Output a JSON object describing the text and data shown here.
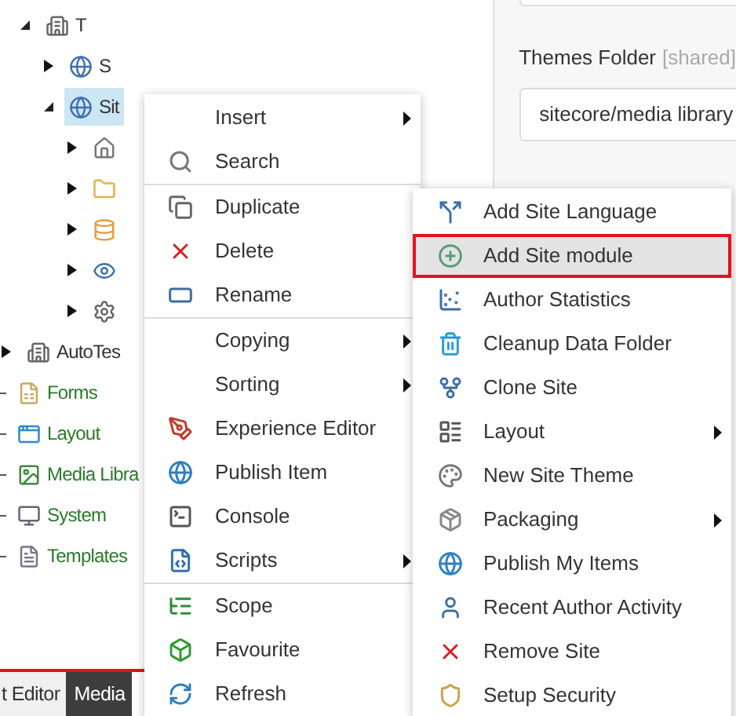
{
  "tree": [
    {
      "children": [
        {
          "label": "T",
          "kind": "building",
          "expanded": true,
          "selected": false,
          "children": [
            {
              "label": "S",
              "kind": "globe",
              "expanded": false,
              "selected": false
            },
            {
              "label": "Sit",
              "kind": "globe",
              "expanded": true,
              "selected": true,
              "children": [
                {
                  "kind": "home",
                  "expanded": false,
                  "selected": false
                },
                {
                  "kind": "folder",
                  "expanded": false,
                  "selected": false
                },
                {
                  "kind": "data",
                  "expanded": false,
                  "selected": false
                },
                {
                  "kind": "eye",
                  "expanded": false,
                  "selected": false
                },
                {
                  "kind": "gear",
                  "expanded": false,
                  "selected": false
                }
              ]
            }
          ]
        }
      ]
    },
    {
      "label": "AutoTes",
      "kind": "building",
      "expanded": false,
      "selected": false
    },
    {
      "label": "Forms",
      "kind": "forms",
      "selected": false,
      "color": "#2b7a2b"
    },
    {
      "label": "Layout",
      "kind": "layout",
      "selected": false,
      "color": "#2b7a2b"
    },
    {
      "label": "Media Libra",
      "kind": "media",
      "selected": false,
      "color": "#2b7a2b"
    },
    {
      "label": "System",
      "kind": "system",
      "selected": false,
      "color": "#2b7a2b"
    },
    {
      "label": "Templates",
      "kind": "templates",
      "selected": false,
      "color": "#2b7a2b"
    }
  ],
  "editor": {
    "field_label": "Themes Folder",
    "field_tag": "[shared]",
    "field_value": "sitecore/media library"
  },
  "bottom_tabs": [
    {
      "label": "t Editor",
      "selected": false
    },
    {
      "label": "Media",
      "selected": true
    }
  ],
  "context_menu": {
    "sections": [
      [
        {
          "label": "Insert",
          "has_submenu": true
        },
        {
          "label": "Search",
          "has_submenu": false
        }
      ],
      [
        {
          "label": "Duplicate",
          "has_submenu": false
        },
        {
          "label": "Delete",
          "has_submenu": false
        },
        {
          "label": "Rename",
          "has_submenu": false
        }
      ],
      [
        {
          "label": "Copying",
          "has_submenu": true
        },
        {
          "label": "Sorting",
          "has_submenu": true
        },
        {
          "label": "Experience Editor",
          "has_submenu": false
        },
        {
          "label": "Publish Item",
          "has_submenu": false
        },
        {
          "label": "Console",
          "has_submenu": false
        },
        {
          "label": "Scripts",
          "has_submenu": true
        }
      ],
      [
        {
          "label": "Scope",
          "has_submenu": false
        },
        {
          "label": "Favourite",
          "has_submenu": false
        },
        {
          "label": "Refresh",
          "has_submenu": false
        }
      ]
    ]
  },
  "submenu": {
    "items": [
      {
        "label": "Add Site Language",
        "has_submenu": false,
        "selected": false
      },
      {
        "label": "Add Site module",
        "has_submenu": false,
        "selected": true
      },
      {
        "label": "Author Statistics",
        "has_submenu": false,
        "selected": false
      },
      {
        "label": "Cleanup Data Folder",
        "has_submenu": false,
        "selected": false
      },
      {
        "label": "Clone Site",
        "has_submenu": false,
        "selected": false
      },
      {
        "label": "Layout",
        "has_submenu": true,
        "selected": false
      },
      {
        "label": "New Site Theme",
        "has_submenu": false,
        "selected": false
      },
      {
        "label": "Packaging",
        "has_submenu": true,
        "selected": false
      },
      {
        "label": "Publish My Items",
        "has_submenu": false,
        "selected": false
      },
      {
        "label": "Recent Author Activity",
        "has_submenu": false,
        "selected": false
      },
      {
        "label": "Remove Site",
        "has_submenu": false,
        "selected": false
      },
      {
        "label": "Setup Security",
        "has_submenu": false,
        "selected": false
      }
    ]
  }
}
